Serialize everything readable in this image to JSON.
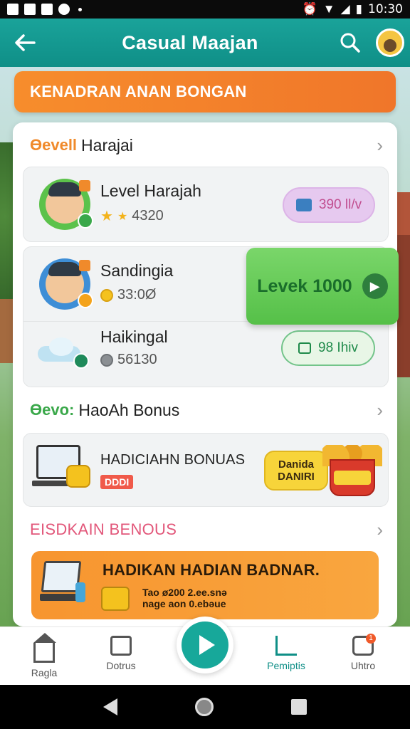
{
  "status_bar": {
    "time": "10:30"
  },
  "app_bar": {
    "title": "Casual Maajan",
    "back_icon": "arrow-left-icon",
    "search_icon": "search-icon"
  },
  "top_banner": {
    "text": "KENADRAN ANAN BONGAN"
  },
  "leaderboard": {
    "brand": "Ɵevell",
    "title": "Harajai",
    "rows": [
      {
        "name": "Level Harajah",
        "score": "4320",
        "action": "390 ll/v"
      },
      {
        "name": "Sandingia",
        "score": "33:0Ø",
        "action": "Levek 1000"
      },
      {
        "name": "Haikingal",
        "score": "56130",
        "action": "98 Ihiv"
      }
    ]
  },
  "daily_bonus": {
    "brand": "Ɵevo:",
    "title": "HaoAh Bonus",
    "card_title": "HADICIAHN BONUAS",
    "card_tag": "DDDI",
    "badge_line1": "Danida",
    "badge_line2": "DANIRI"
  },
  "event_bonus": {
    "title": "EISDKAIN BENOUS",
    "promo_title": "HADIKAN HADIAN BADNAR.",
    "promo_line1": "Tao ø200 2.ee.snə",
    "promo_line2": "nage aon 0.ebəue"
  },
  "bottom_nav": {
    "items": [
      "Ragla",
      "Dotrus",
      "Pemiptis",
      "Uhtro"
    ],
    "notify_count": "1"
  },
  "colors": {
    "primary": "#0f8f87",
    "accent": "#f0762a",
    "level_button": "#55c048"
  }
}
